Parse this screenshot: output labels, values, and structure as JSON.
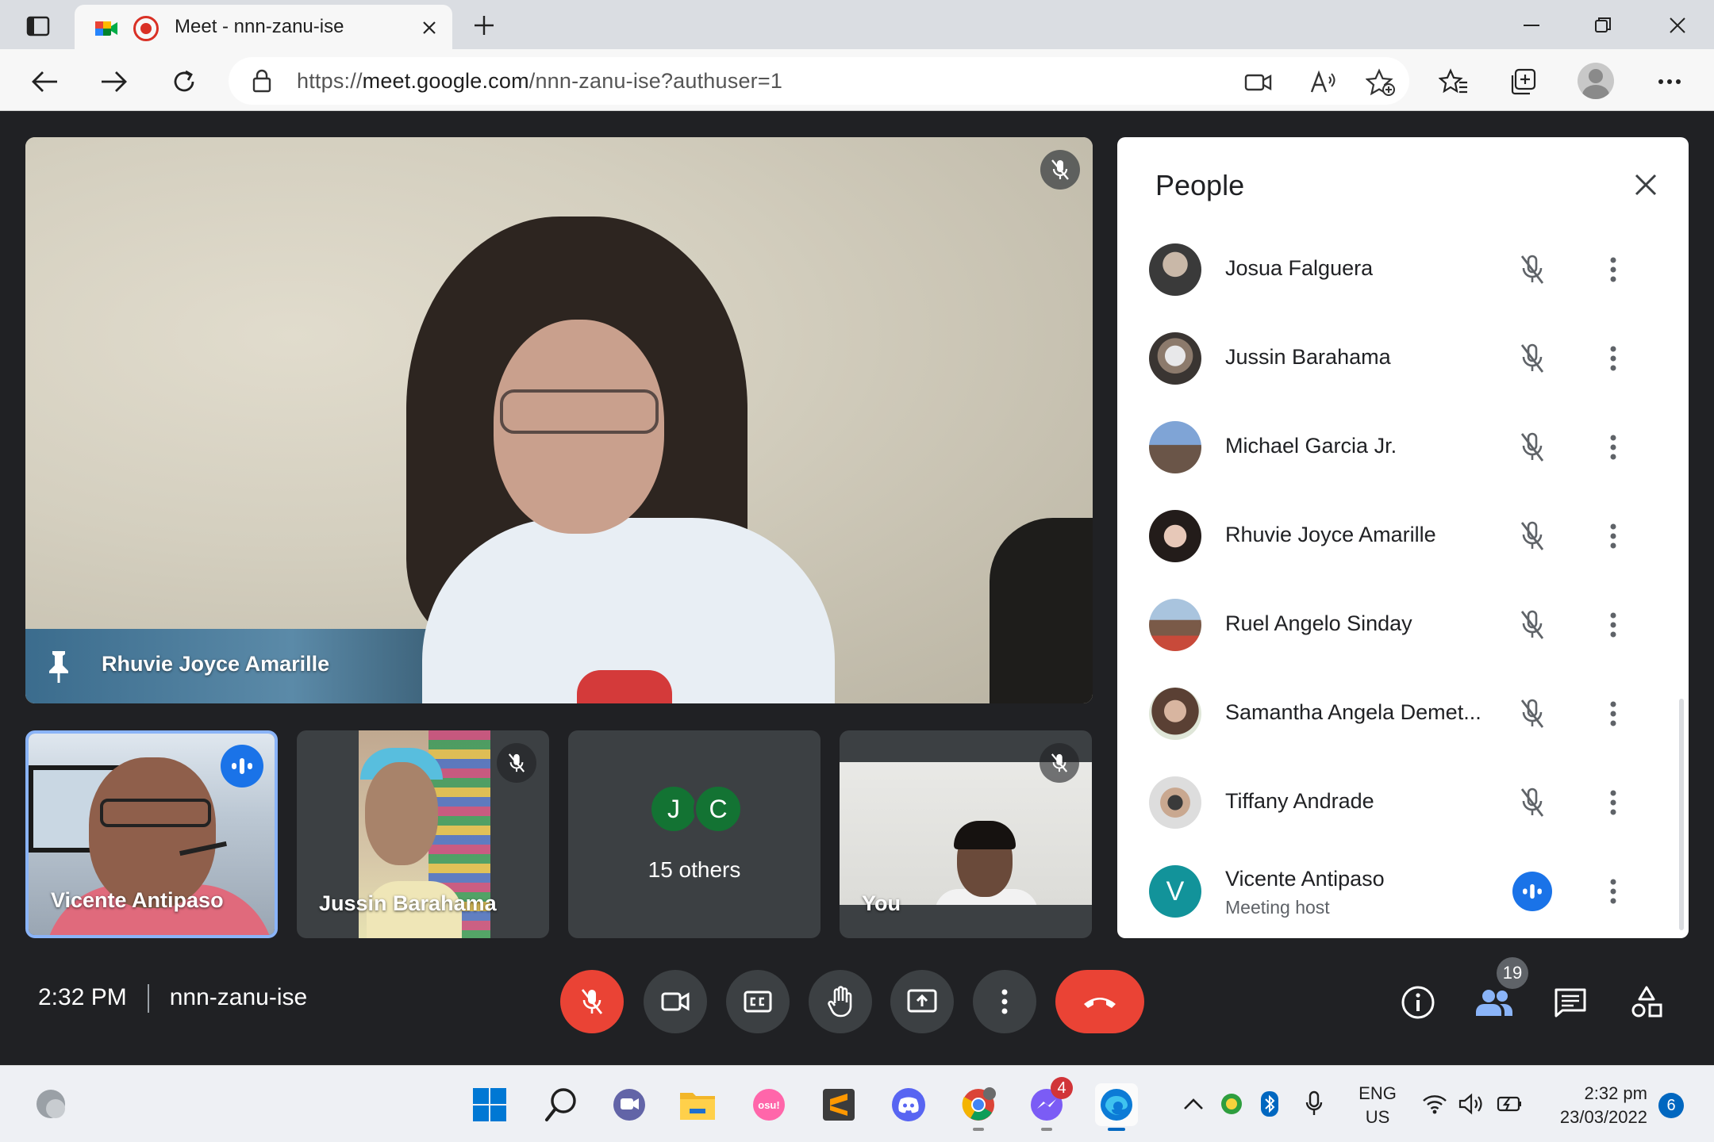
{
  "browser": {
    "tab_title": "Meet - nnn-zanu-ise",
    "url_prefix": "https://",
    "url_host": "meet.google.com",
    "url_path": "/nnn-zanu-ise?authuser=1"
  },
  "meeting": {
    "time": "2:32 PM",
    "code": "nnn-zanu-ise",
    "participant_count": "19"
  },
  "main_tile": {
    "name": "Rhuvie Joyce Amarille"
  },
  "tiles": [
    {
      "name": "Vicente Antipaso"
    },
    {
      "name": "Jussin Barahama"
    },
    {
      "avatars": [
        "J",
        "C"
      ],
      "label": "15 others"
    },
    {
      "name": "You"
    }
  ],
  "people_panel": {
    "title": "People",
    "participants": [
      {
        "name": "Josua Falguera"
      },
      {
        "name": "Jussin Barahama"
      },
      {
        "name": "Michael Garcia Jr."
      },
      {
        "name": "Rhuvie Joyce Amarille"
      },
      {
        "name": "Ruel Angelo Sinday"
      },
      {
        "name": "Samantha Angela Demet..."
      },
      {
        "name": "Tiffany Andrade"
      },
      {
        "name": "Vicente Antipaso",
        "subtitle": "Meeting host",
        "initial": "V"
      }
    ]
  },
  "taskbar": {
    "lang_top": "ENG",
    "lang_bottom": "US",
    "time": "2:32 pm",
    "date": "23/03/2022",
    "notification_count": "6",
    "messenger_badge": "4",
    "osu_label": "osu!"
  },
  "colors": {
    "meet_bg": "#202124",
    "control_gray": "#3c4043",
    "end_red": "#ea4335",
    "speaking_blue": "#1a73e8",
    "tile_highlight": "#8ab4f8"
  }
}
